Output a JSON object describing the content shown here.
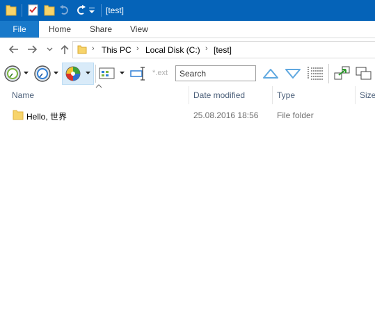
{
  "window": {
    "title": "[test]",
    "quick_access_icons": [
      "folder-icon",
      "properties-check-icon",
      "new-folder-icon",
      "undo-icon",
      "redo-icon",
      "customize-dropdown-icon"
    ]
  },
  "ribbon": {
    "tabs": [
      "File",
      "Home",
      "Share",
      "View"
    ]
  },
  "address": {
    "breadcrumbs": [
      "This PC",
      "Local Disk (C:)",
      "[test]"
    ]
  },
  "toolbar": {
    "search_label": "Search",
    "ext_label": "*.ext"
  },
  "columns": [
    "Name",
    "Date modified",
    "Type",
    "Size"
  ],
  "rows": [
    {
      "name": "Hello, 世界",
      "date": "25.08.2016 18:56",
      "type": "File folder"
    }
  ],
  "colors": {
    "titlebar": "#0563b8",
    "file_tab": "#1979ca",
    "header_text": "#4c607a",
    "folder": "#f7d46b"
  }
}
